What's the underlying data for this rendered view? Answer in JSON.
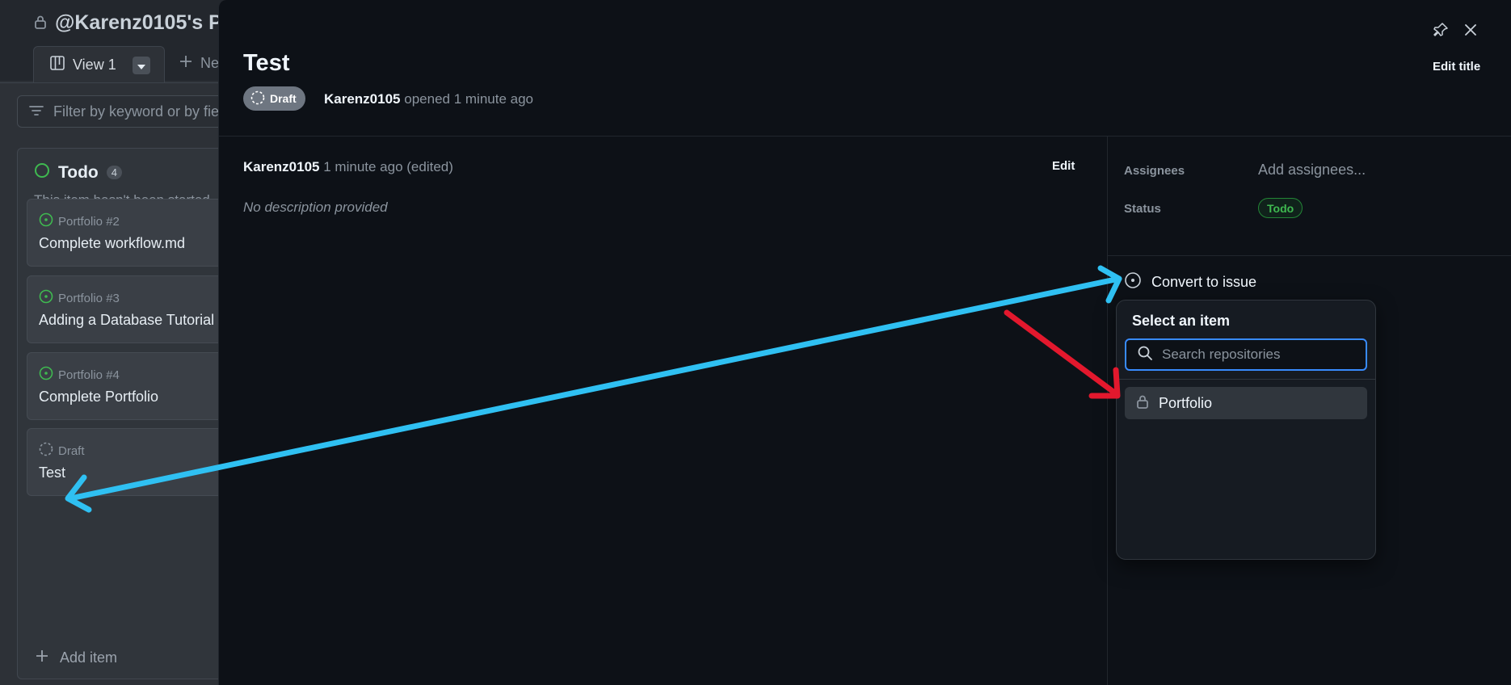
{
  "board": {
    "title": "@Karenz0105's Po",
    "view_tab_label": "View 1",
    "new_view_label": "Ne",
    "filter_placeholder": "Filter by keyword or by fiel",
    "column": {
      "title": "Todo",
      "count": "4",
      "description": "This item hasn't been started",
      "cards": [
        {
          "meta": "Portfolio #2",
          "title": "Complete workflow.md",
          "type": "issue"
        },
        {
          "meta": "Portfolio #3",
          "title": "Adding a Database Tutorial",
          "type": "issue"
        },
        {
          "meta": "Portfolio #4",
          "title": "Complete Portfolio",
          "type": "issue"
        },
        {
          "meta": "Draft",
          "title": "Test",
          "type": "draft"
        }
      ],
      "add_item_label": "Add item"
    }
  },
  "panel": {
    "title": "Test",
    "edit_title_label": "Edit title",
    "draft_label": "Draft",
    "author": "Karenz0105",
    "opened_text": "opened 1 minute ago",
    "comment": {
      "author": "Karenz0105",
      "time": "1 minute ago (edited)",
      "edit_label": "Edit",
      "body": "No description provided"
    },
    "fields": {
      "assignees_label": "Assignees",
      "assignees_value": "Add assignees...",
      "status_label": "Status",
      "status_value": "Todo"
    },
    "convert_label": "Convert to issue",
    "dropdown": {
      "title": "Select an item",
      "search_placeholder": "Search repositories",
      "items": [
        {
          "label": "Portfolio",
          "private": true
        }
      ]
    }
  },
  "colors": {
    "arrow_blue": "#2fc0f2",
    "arrow_red": "#e3182d",
    "accent_green": "#3fb950",
    "focus_blue": "#388bfd"
  },
  "icons": [
    "lock-icon",
    "board-view-icon",
    "caret-down-icon",
    "plus-icon",
    "filter-icon",
    "issue-open-icon",
    "draft-icon",
    "pin-icon",
    "close-icon",
    "search-icon"
  ]
}
